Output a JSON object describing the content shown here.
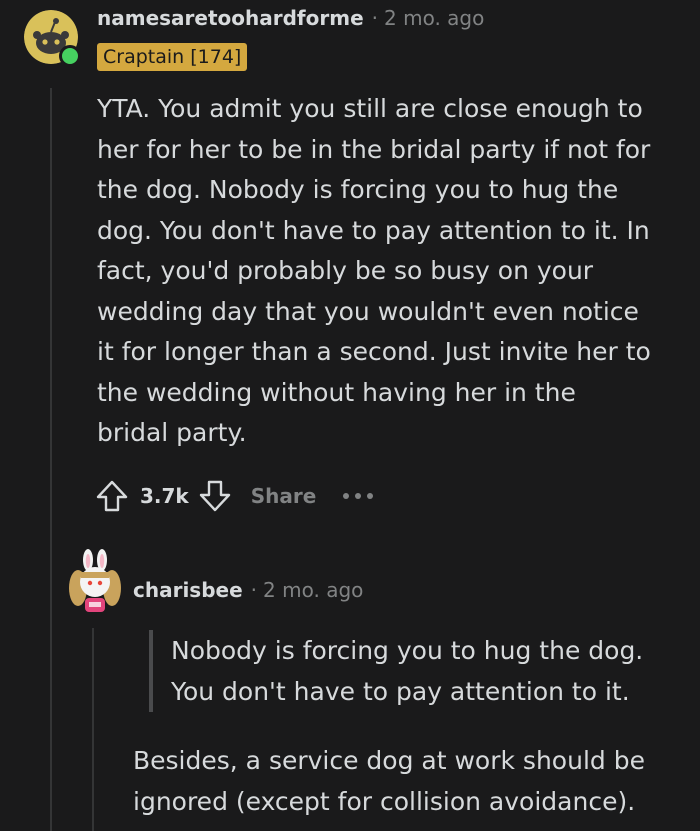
{
  "comment": {
    "username": "namesaretoohardforme",
    "separator": "·",
    "timestamp": "2 mo. ago",
    "flair": "Craptain [174]",
    "body": [
      "YTA. You admit you still are close enough to",
      "her for her to be in the bridal party if not for",
      "the dog. Nobody is forcing you to hug the",
      "dog. You don't have to pay attention to it. In",
      "fact, you'd probably be so busy on your",
      "wedding day that you wouldn't even notice",
      "it for longer than a second. Just invite her to",
      "the wedding without having her in the",
      "bridal party."
    ],
    "votes": "3.7k",
    "share_label": "Share",
    "icons": {
      "avatar": "snoo-avatar-icon",
      "online": "online-status-icon",
      "upvote": "upvote-arrow-icon",
      "downvote": "downvote-arrow-icon",
      "more": "more-options-icon"
    }
  },
  "reply": {
    "username": "charisbee",
    "separator": "·",
    "timestamp": "2 mo. ago",
    "quote": [
      "Nobody is forcing you to hug the dog.",
      "You don't have to pay attention to it."
    ],
    "body": [
      "Besides, a service dog at work should be",
      "ignored (except for collision avoidance)."
    ],
    "icons": {
      "avatar": "bunny-ears-avatar-icon"
    }
  },
  "colors": {
    "background": "#1a1a1b",
    "text": "#d7dadc",
    "muted": "#818384",
    "flair": "#d4a83f",
    "online": "#46d160",
    "thread_line": "#343536"
  }
}
